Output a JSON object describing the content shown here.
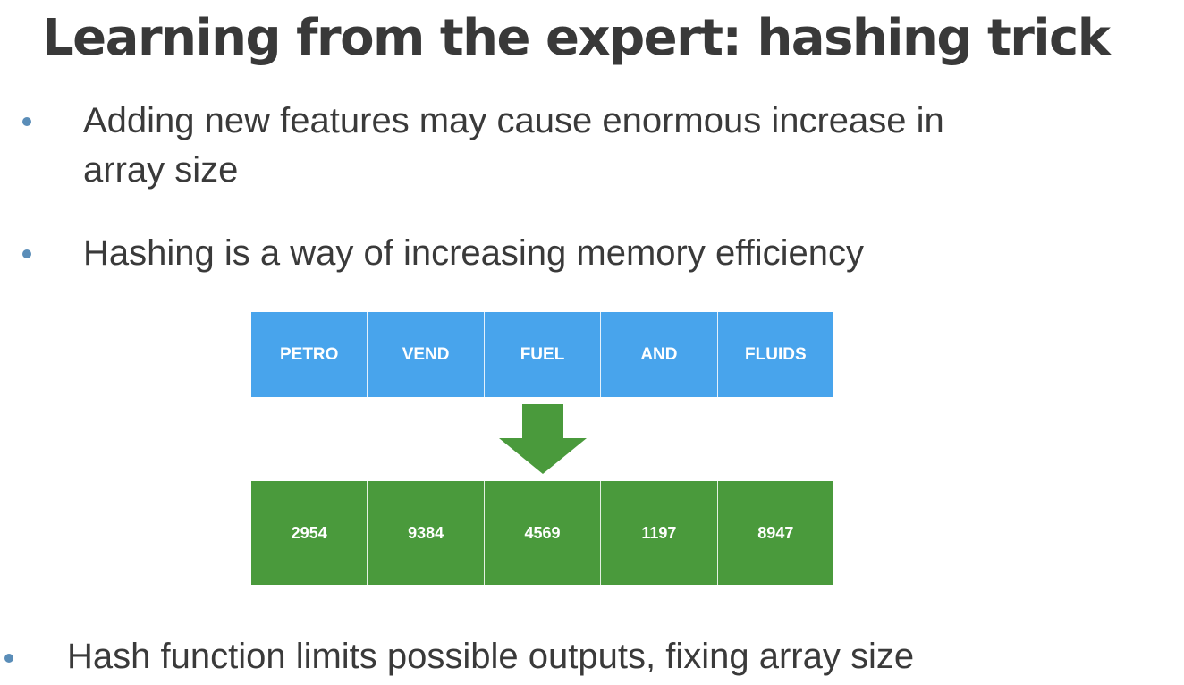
{
  "slide": {
    "title": "Learning from the expert: hashing trick",
    "bullets_top": [
      {
        "line1": "Adding new features may cause enormous increase in",
        "line2": "array size"
      },
      {
        "line1": "Hashing is a way of increasing memory efficiency"
      }
    ],
    "bullet_bottom": "Hash function limits possible outputs, fixing array size",
    "colors": {
      "bullet": "#5a8db8",
      "token_row": "#48a4ec",
      "hash_row": "#4a9a3c",
      "arrow": "#4a9a3c"
    }
  },
  "diagram": {
    "tokens": [
      "PETRO",
      "VEND",
      "FUEL",
      "AND",
      "FLUIDS"
    ],
    "arrow_icon": "down-arrow-icon",
    "hashes": [
      "2954",
      "9384",
      "4569",
      "1197",
      "8947"
    ]
  }
}
